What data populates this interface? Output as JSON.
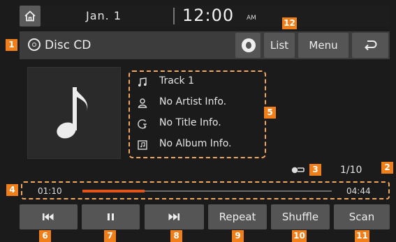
{
  "status_bar": {
    "date": "Jan.  1",
    "time": "12:00",
    "ampm": "AM"
  },
  "header": {
    "source_title": "Disc CD",
    "list_label": "List",
    "menu_label": "Menu"
  },
  "now_playing": {
    "track": "Track 1",
    "artist": "No Artist Info.",
    "title": "No Title Info.",
    "album": "No Album Info.",
    "track_count": "1/10"
  },
  "progress": {
    "elapsed": "01:10",
    "total": "04:44",
    "fraction": 0.25
  },
  "controls": {
    "repeat_label": "Repeat",
    "shuffle_label": "Shuffle",
    "scan_label": "Scan"
  },
  "callouts": {
    "disc_title": "1",
    "repeat_mode": "3",
    "time_bar": "4",
    "song_info": "5",
    "prev": "6",
    "pause": "7",
    "next": "8",
    "repeat": "9",
    "shuffle": "10",
    "scan": "11",
    "list": "12",
    "track_count": "2"
  },
  "colors": {
    "accent": "#f07f1a",
    "progress_fill": "#e2541c"
  },
  "icons": {
    "home": "home-icon",
    "disc": "disc-icon",
    "logo": "brand-logo-icon",
    "back": "back-icon",
    "note": "music-note-icon",
    "artist": "person-icon",
    "title": "title-icon",
    "album": "album-icon",
    "repeat_mode": "repeat-mode-icon",
    "prev": "previous-track-icon",
    "pause": "pause-icon",
    "next": "next-track-icon"
  }
}
